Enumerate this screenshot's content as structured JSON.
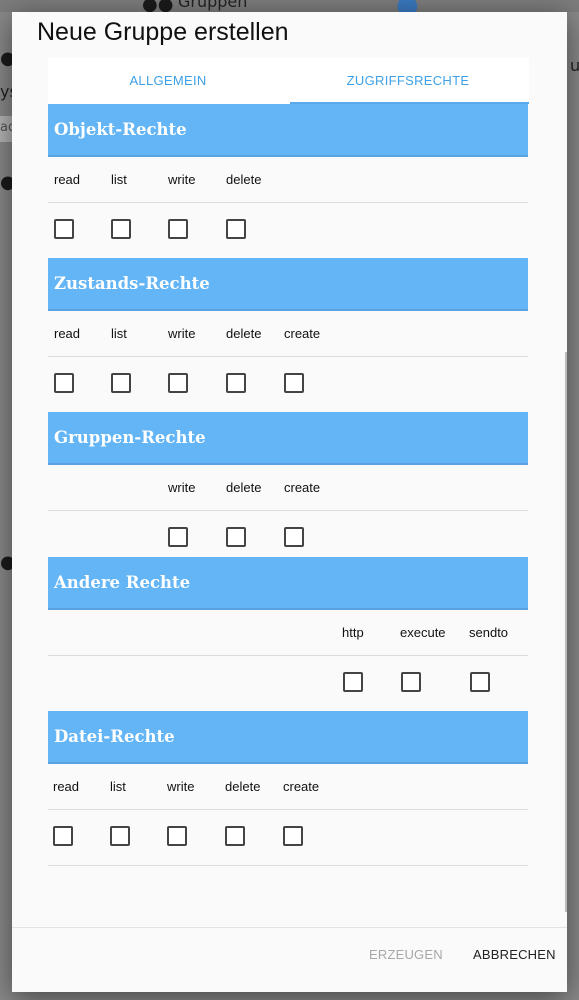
{
  "dialog": {
    "title": "Neue Gruppe erstellen",
    "tabs": [
      {
        "label": "ALLGEMEIN",
        "active": false
      },
      {
        "label": "ZUGRIFFSRECHTE",
        "active": true
      }
    ]
  },
  "sections": {
    "object": {
      "title": "Objekt-Rechte",
      "perms": [
        "read",
        "list",
        "write",
        "delete"
      ]
    },
    "state": {
      "title": "Zustands-Rechte",
      "perms": [
        "read",
        "list",
        "write",
        "delete",
        "create"
      ]
    },
    "group": {
      "title": "Gruppen-Rechte",
      "perms": [
        "write",
        "delete",
        "create"
      ]
    },
    "other": {
      "title": "Andere Rechte",
      "perms": [
        "http",
        "execute",
        "sendto"
      ]
    },
    "file": {
      "title": "Datei-Rechte",
      "perms": [
        "read",
        "list",
        "write",
        "delete",
        "create"
      ]
    }
  },
  "footer": {
    "create_label": "ERZEUGEN",
    "cancel_label": "ABBRECHEN"
  },
  "colors": {
    "accent": "#64b5f6",
    "tab_text": "#3ea0e6"
  },
  "background": {
    "peek_text_top": "Gruppen",
    "peek_text_left_1": "ys",
    "peek_text_left_2": "ad",
    "peek_text_right": "u"
  }
}
